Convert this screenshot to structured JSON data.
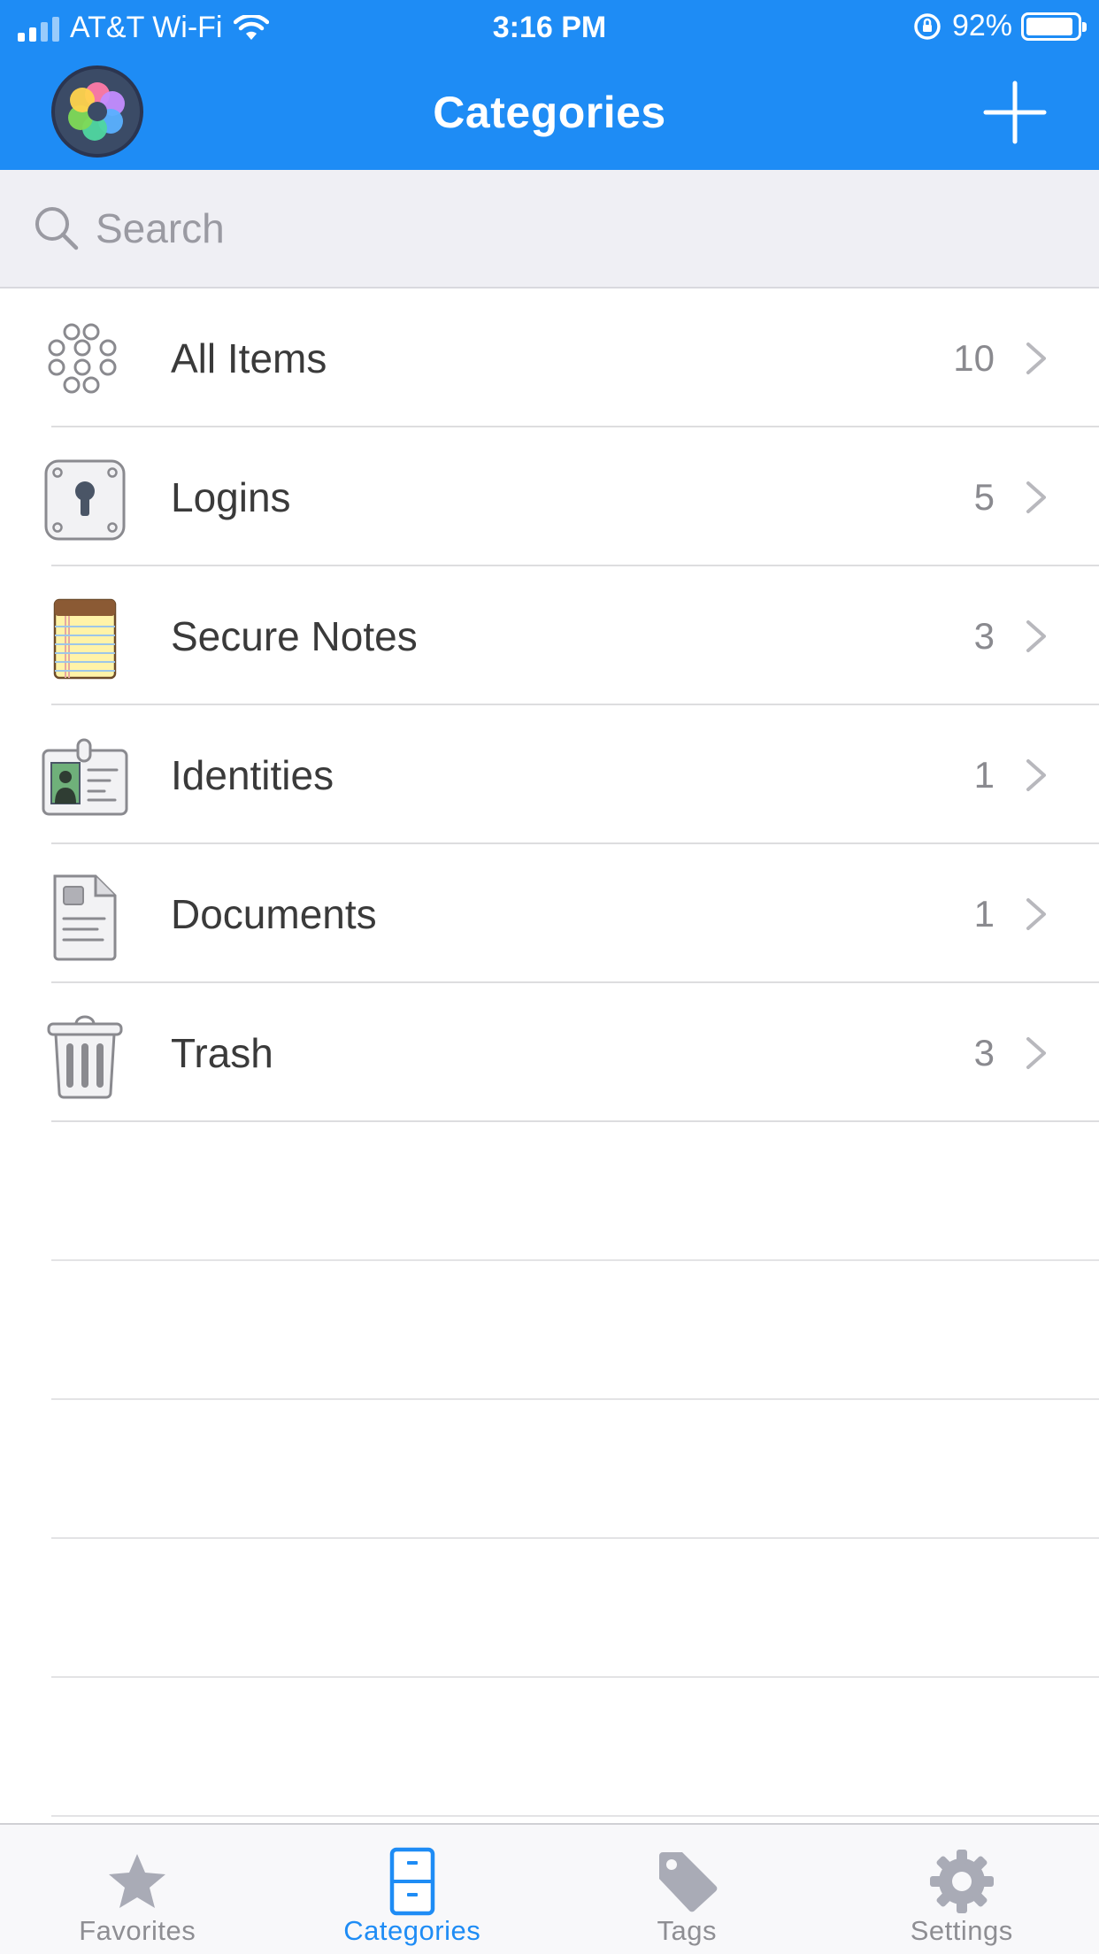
{
  "status_bar": {
    "carrier": "AT&T Wi-Fi",
    "time": "3:16 PM",
    "battery": "92%",
    "battery_level": 0.92
  },
  "nav": {
    "title": "Categories"
  },
  "search": {
    "placeholder": "Search"
  },
  "categories": [
    {
      "label": "All Items",
      "count": "10",
      "icon": "all-items-icon"
    },
    {
      "label": "Logins",
      "count": "5",
      "icon": "login-keyhole-icon"
    },
    {
      "label": "Secure Notes",
      "count": "3",
      "icon": "notepad-icon"
    },
    {
      "label": "Identities",
      "count": "1",
      "icon": "id-badge-icon"
    },
    {
      "label": "Documents",
      "count": "1",
      "icon": "document-icon"
    },
    {
      "label": "Trash",
      "count": "3",
      "icon": "trash-icon"
    }
  ],
  "tabs": [
    {
      "label": "Favorites",
      "icon": "star-icon",
      "active": false
    },
    {
      "label": "Categories",
      "icon": "file-cabinet-icon",
      "active": true
    },
    {
      "label": "Tags",
      "icon": "tag-icon",
      "active": false
    },
    {
      "label": "Settings",
      "icon": "gear-icon",
      "active": false
    }
  ],
  "colors": {
    "brand_blue": "#1E8CF5",
    "inactive_tab": "#8E8E93",
    "search_bg": "#EFEFF4"
  }
}
